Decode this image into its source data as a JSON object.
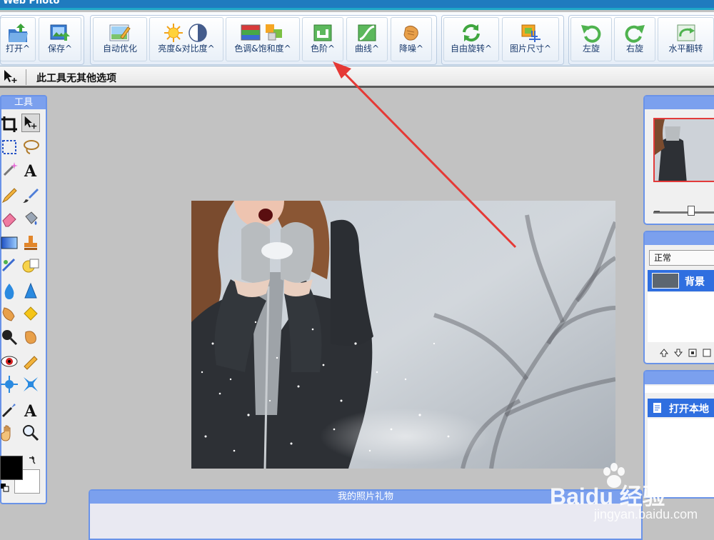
{
  "app": {
    "title": "Web Photo"
  },
  "toolbar": {
    "buttons": [
      {
        "label": "打开^"
      },
      {
        "label": "保存^"
      },
      {
        "label": "自动优化"
      },
      {
        "label": "亮度&对比度^"
      },
      {
        "label": "色调&饱和度^"
      },
      {
        "label": "色阶^"
      },
      {
        "label": "曲线^"
      },
      {
        "label": "降噪^"
      },
      {
        "label": "自由旋转^"
      },
      {
        "label": "图片尺寸^"
      },
      {
        "label": "左旋"
      },
      {
        "label": "右旋"
      },
      {
        "label": "水平翻转"
      }
    ]
  },
  "options_bar": {
    "text": "此工具无其他选项"
  },
  "tools_panel": {
    "title": "工具"
  },
  "layers": {
    "blend_mode": "正常",
    "layer_name": "背景"
  },
  "history": {
    "item": "打开本地"
  },
  "bottom_panel": {
    "title": "我的照片礼物"
  },
  "watermark": {
    "brand": "Baidu 经验",
    "url": "jingyan.baidu.com"
  },
  "colors": {
    "accent": "#6a93e8",
    "arrow": "#e53935",
    "foreground": "#000000",
    "background": "#ffffff"
  }
}
